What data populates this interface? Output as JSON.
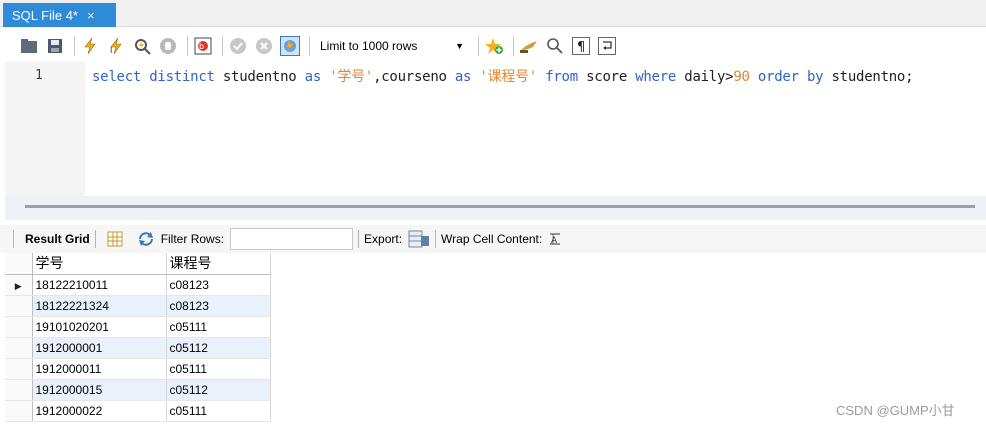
{
  "tab": {
    "title": "SQL File 4*",
    "close_glyph": "×"
  },
  "toolbar": {
    "icons": [
      "folder-open-icon",
      "save-icon",
      "execute-icon",
      "execute-current-icon",
      "explain-icon",
      "stop-icon",
      "toggle-continue-icon",
      "commit-icon",
      "rollback-icon",
      "toggle-autocommit-icon"
    ],
    "limit_label": "Limit to 1000 rows",
    "limit_caret": "▼",
    "icons_right": [
      "add-snippet-icon",
      "beautify-icon",
      "find-icon",
      "invisible-chars-icon",
      "wrap-lines-icon"
    ]
  },
  "editor": {
    "line_number": "1",
    "tokens": [
      {
        "t": "kw",
        "v": "select distinct "
      },
      {
        "t": "plain",
        "v": "studentno "
      },
      {
        "t": "kw",
        "v": "as "
      },
      {
        "t": "str",
        "v": "'学号'"
      },
      {
        "t": "plain",
        "v": ",courseno "
      },
      {
        "t": "kw",
        "v": "as "
      },
      {
        "t": "str",
        "v": "'课程号' "
      },
      {
        "t": "kw",
        "v": "from "
      },
      {
        "t": "plain",
        "v": "score "
      },
      {
        "t": "kw",
        "v": "where "
      },
      {
        "t": "plain",
        "v": "daily>"
      },
      {
        "t": "num",
        "v": "90 "
      },
      {
        "t": "kw",
        "v": "order by "
      },
      {
        "t": "plain",
        "v": "studentno;"
      }
    ]
  },
  "results_toolbar": {
    "result_grid_label": "Result Grid",
    "filter_label": "Filter Rows:",
    "filter_value": "",
    "export_label": "Export:",
    "wrap_label": "Wrap Cell Content:"
  },
  "grid": {
    "columns": [
      "学号",
      "课程号"
    ],
    "rows": [
      [
        "18122210011",
        "c08123"
      ],
      [
        "18122221324",
        "c08123"
      ],
      [
        "19101020201",
        "c05111"
      ],
      [
        "1912000001",
        "c05112"
      ],
      [
        "1912000011",
        "c05111"
      ],
      [
        "1912000015",
        "c05112"
      ],
      [
        "1912000022",
        "c05111"
      ]
    ],
    "current_row_marker": "▶"
  },
  "watermark": "CSDN @GUMP小甘",
  "colors": {
    "tab_accent": "#2f8bd8",
    "keyword": "#2e64c5",
    "string": "#e6852f"
  }
}
